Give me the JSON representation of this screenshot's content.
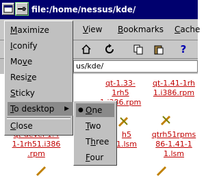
{
  "window": {
    "title": "file:/home/nessus/kde/"
  },
  "menubar": [
    {
      "name": "view",
      "label": "View",
      "underline": "V",
      "rest": "iew"
    },
    {
      "name": "bookmarks",
      "label": "Bookmarks",
      "underline": "B",
      "rest": "ookmarks"
    },
    {
      "name": "cache",
      "label": "Cache",
      "underline": "C",
      "rest": "ache"
    }
  ],
  "toolbar": {
    "icons": [
      "home-icon",
      "reload-icon",
      "copy-icon",
      "paste-icon",
      "help-icon"
    ],
    "glyphs": [
      "⌂",
      "↻",
      "⎘",
      "📋",
      "?"
    ]
  },
  "location": {
    "value": "us/kde/"
  },
  "files": [
    {
      "line1": "qt-1.33-1rh5",
      "line2": "1.i386.rpm"
    },
    {
      "line1": "qt-1.41-1rh",
      "line2": "1.i386.rpm"
    },
    {
      "line1": "qt-1.33-1rh5",
      "line2": "1.i386.rpm"
    },
    {
      "line1": "qt-1.41-1rh",
      "line2": "1.i386.rpm"
    },
    {
      "line1": "qt-devel-1.4",
      "line2": "1-1rh51.i386",
      "line3": ".rpm"
    },
    {
      "line1": "5",
      "line2": "rpm"
    },
    {
      "line1": "h5",
      "line2": "1.lsm"
    },
    {
      "line1": "qtrh51rpms",
      "line2": "86-1.41-1",
      "line3": "1.lsm"
    }
  ],
  "window_menu": {
    "items": [
      {
        "name": "maximize",
        "u": "M",
        "rest": "aximize"
      },
      {
        "name": "iconify",
        "u": "I",
        "rest": "conify"
      },
      {
        "name": "move",
        "pre": "Mo",
        "u": "v",
        "rest": "e"
      },
      {
        "name": "resize",
        "pre": "Resi",
        "u": "z",
        "rest": "e"
      },
      {
        "name": "sticky",
        "u": "S",
        "rest": "ticky"
      },
      {
        "name": "to-desktop",
        "u": "T",
        "rest": "o desktop"
      },
      {
        "name": "close",
        "u": "C",
        "rest": "lose"
      }
    ]
  },
  "desktop_submenu": {
    "items": [
      {
        "name": "one",
        "u": "O",
        "rest": "ne",
        "checked": true
      },
      {
        "name": "two",
        "u": "T",
        "rest": "wo"
      },
      {
        "name": "three",
        "pre": "T",
        "u": "h",
        "rest": "ree"
      },
      {
        "name": "four",
        "u": "F",
        "rest": "our"
      }
    ]
  },
  "colors": {
    "titlebar": "#00006e",
    "menu_bg": "#c0c0c0",
    "link": "#c00000",
    "highlight": "#8a8a8a"
  }
}
